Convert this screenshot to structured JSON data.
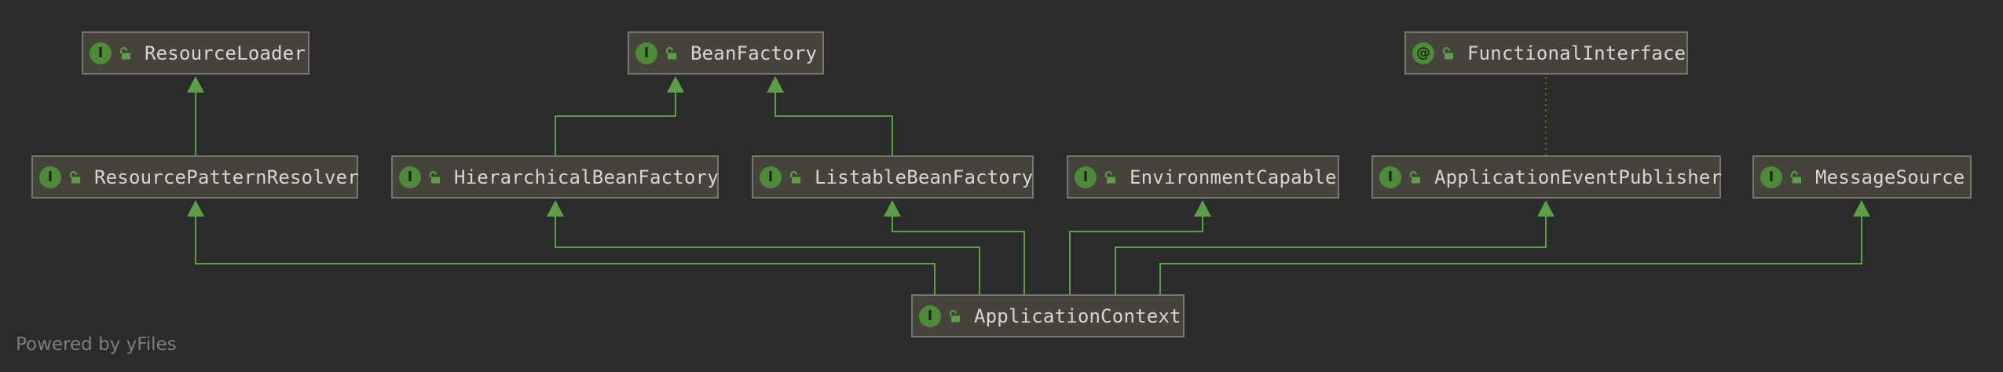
{
  "diagram": {
    "nodes": [
      {
        "id": "resource-loader",
        "label": "ResourceLoader",
        "badge": "I",
        "kind": "interface"
      },
      {
        "id": "bean-factory",
        "label": "BeanFactory",
        "badge": "I",
        "kind": "interface"
      },
      {
        "id": "functional-interface",
        "label": "FunctionalInterface",
        "badge": "@",
        "kind": "annotation"
      },
      {
        "id": "resource-pattern-resolver",
        "label": "ResourcePatternResolver",
        "badge": "I",
        "kind": "interface"
      },
      {
        "id": "hierarchical-bean-factory",
        "label": "HierarchicalBeanFactory",
        "badge": "I",
        "kind": "interface"
      },
      {
        "id": "listable-bean-factory",
        "label": "ListableBeanFactory",
        "badge": "I",
        "kind": "interface"
      },
      {
        "id": "environment-capable",
        "label": "EnvironmentCapable",
        "badge": "I",
        "kind": "interface"
      },
      {
        "id": "application-event-publisher",
        "label": "ApplicationEventPublisher",
        "badge": "I",
        "kind": "interface"
      },
      {
        "id": "message-source",
        "label": "MessageSource",
        "badge": "I",
        "kind": "interface"
      },
      {
        "id": "application-context",
        "label": "ApplicationContext",
        "badge": "I",
        "kind": "interface"
      }
    ],
    "edges": [
      {
        "from": "resource-pattern-resolver",
        "to": "resource-loader",
        "type": "extends"
      },
      {
        "from": "hierarchical-bean-factory",
        "to": "bean-factory",
        "type": "extends"
      },
      {
        "from": "listable-bean-factory",
        "to": "bean-factory",
        "type": "extends"
      },
      {
        "from": "application-event-publisher",
        "to": "functional-interface",
        "type": "annotated-with"
      },
      {
        "from": "application-context",
        "to": "resource-pattern-resolver",
        "type": "extends"
      },
      {
        "from": "application-context",
        "to": "hierarchical-bean-factory",
        "type": "extends"
      },
      {
        "from": "application-context",
        "to": "listable-bean-factory",
        "type": "extends"
      },
      {
        "from": "application-context",
        "to": "environment-capable",
        "type": "extends"
      },
      {
        "from": "application-context",
        "to": "application-event-publisher",
        "type": "extends"
      },
      {
        "from": "application-context",
        "to": "message-source",
        "type": "extends"
      }
    ]
  },
  "colors": {
    "background": "#2b2b2b",
    "node_fill": "#45433c",
    "node_border": "#77766f",
    "edge": "#5f9e48",
    "badge": "#4f8a3a",
    "label": "#d6d6d6",
    "footer": "#7e7e7e"
  },
  "icons": {
    "interface_badge": "interface-badge-icon",
    "annotation_badge": "annotation-badge-icon",
    "visibility": "unlocked-lock-icon"
  },
  "footer": {
    "text": "Powered by yFiles"
  }
}
